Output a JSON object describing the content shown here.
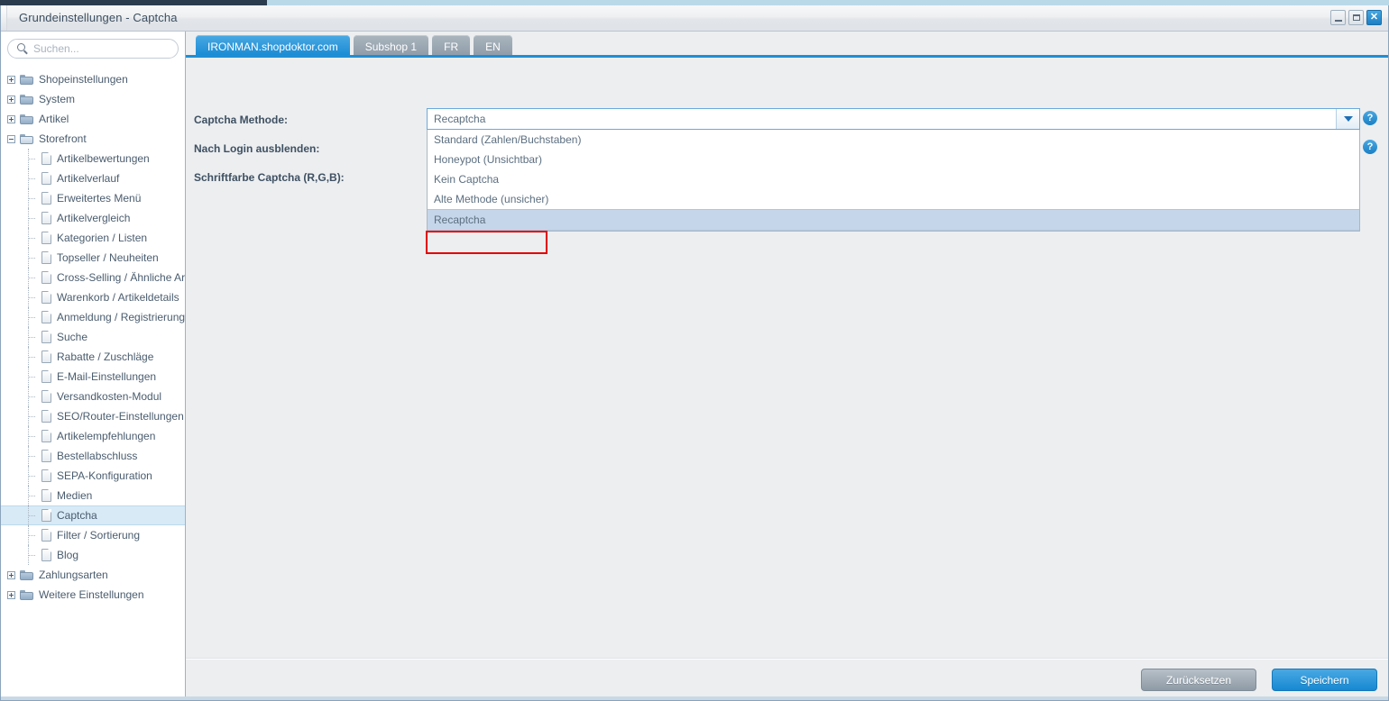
{
  "window": {
    "title": "Grundeinstellungen - Captcha",
    "controls": {
      "minimize": "_",
      "maximize": "❐",
      "close": "✕"
    }
  },
  "sidebar": {
    "search": {
      "placeholder": "Suchen...",
      "value": ""
    },
    "tree": [
      {
        "label": "Shopeinstellungen",
        "level": 0,
        "type": "folder",
        "state": "collapsed",
        "selected": false
      },
      {
        "label": "System",
        "level": 0,
        "type": "folder",
        "state": "collapsed",
        "selected": false
      },
      {
        "label": "Artikel",
        "level": 0,
        "type": "folder",
        "state": "collapsed",
        "selected": false
      },
      {
        "label": "Storefront",
        "level": 0,
        "type": "folder",
        "state": "expanded",
        "selected": false
      },
      {
        "label": "Artikelbewertungen",
        "level": 1,
        "type": "file",
        "state": "none",
        "selected": false
      },
      {
        "label": "Artikelverlauf",
        "level": 1,
        "type": "file",
        "state": "none",
        "selected": false
      },
      {
        "label": "Erweitertes Menü",
        "level": 1,
        "type": "file",
        "state": "none",
        "selected": false
      },
      {
        "label": "Artikelvergleich",
        "level": 1,
        "type": "file",
        "state": "none",
        "selected": false
      },
      {
        "label": "Kategorien / Listen",
        "level": 1,
        "type": "file",
        "state": "none",
        "selected": false
      },
      {
        "label": "Topseller / Neuheiten",
        "level": 1,
        "type": "file",
        "state": "none",
        "selected": false
      },
      {
        "label": "Cross-Selling / Ähnliche Art.",
        "level": 1,
        "type": "file",
        "state": "none",
        "selected": false
      },
      {
        "label": "Warenkorb / Artikeldetails",
        "level": 1,
        "type": "file",
        "state": "none",
        "selected": false
      },
      {
        "label": "Anmeldung / Registrierung",
        "level": 1,
        "type": "file",
        "state": "none",
        "selected": false
      },
      {
        "label": "Suche",
        "level": 1,
        "type": "file",
        "state": "none",
        "selected": false
      },
      {
        "label": "Rabatte / Zuschläge",
        "level": 1,
        "type": "file",
        "state": "none",
        "selected": false
      },
      {
        "label": "E-Mail-Einstellungen",
        "level": 1,
        "type": "file",
        "state": "none",
        "selected": false
      },
      {
        "label": "Versandkosten-Modul",
        "level": 1,
        "type": "file",
        "state": "none",
        "selected": false
      },
      {
        "label": "SEO/Router-Einstellungen",
        "level": 1,
        "type": "file",
        "state": "none",
        "selected": false
      },
      {
        "label": "Artikelempfehlungen",
        "level": 1,
        "type": "file",
        "state": "none",
        "selected": false
      },
      {
        "label": "Bestellabschluss",
        "level": 1,
        "type": "file",
        "state": "none",
        "selected": false
      },
      {
        "label": "SEPA-Konfiguration",
        "level": 1,
        "type": "file",
        "state": "none",
        "selected": false
      },
      {
        "label": "Medien",
        "level": 1,
        "type": "file",
        "state": "none",
        "selected": false
      },
      {
        "label": "Captcha",
        "level": 1,
        "type": "file",
        "state": "none",
        "selected": true
      },
      {
        "label": "Filter / Sortierung",
        "level": 1,
        "type": "file",
        "state": "none",
        "selected": false
      },
      {
        "label": "Blog",
        "level": 1,
        "type": "file",
        "state": "none",
        "selected": false
      },
      {
        "label": "Zahlungsarten",
        "level": 0,
        "type": "folder",
        "state": "collapsed",
        "selected": false
      },
      {
        "label": "Weitere Einstellungen",
        "level": 0,
        "type": "folder",
        "state": "collapsed",
        "selected": false
      }
    ]
  },
  "content": {
    "tabs": [
      {
        "label": "IRONMAN.shopdoktor.com",
        "active": true
      },
      {
        "label": "Subshop 1",
        "active": false
      },
      {
        "label": "FR",
        "active": false
      },
      {
        "label": "EN",
        "active": false
      }
    ],
    "form": {
      "labels": {
        "captcha_method": "Captcha Methode:",
        "hide_after_login": "Nach Login ausblenden:",
        "font_color": "Schriftfarbe Captcha (R,G,B):"
      },
      "captcha_method": {
        "value": "Recaptcha",
        "expanded": true,
        "options": [
          {
            "label": "Standard (Zahlen/Buchstaben)",
            "selected": false
          },
          {
            "label": "Honeypot (Unsichtbar)",
            "selected": false
          },
          {
            "label": "Kein Captcha",
            "selected": false
          },
          {
            "label": "Alte Methode (unsicher)",
            "selected": false
          },
          {
            "label": "Recaptcha",
            "selected": true
          }
        ]
      },
      "help_markers": [
        "?",
        "?"
      ]
    },
    "footer": {
      "reset_label": "Zurücksetzen",
      "save_label": "Speichern"
    }
  },
  "colors": {
    "accent_blue": "#1688d2",
    "tab_inactive": "#8d9aa6",
    "selection_blue": "#d8eaf6",
    "option_selected": "#c5d6ea",
    "marker_red": "#e20000"
  }
}
